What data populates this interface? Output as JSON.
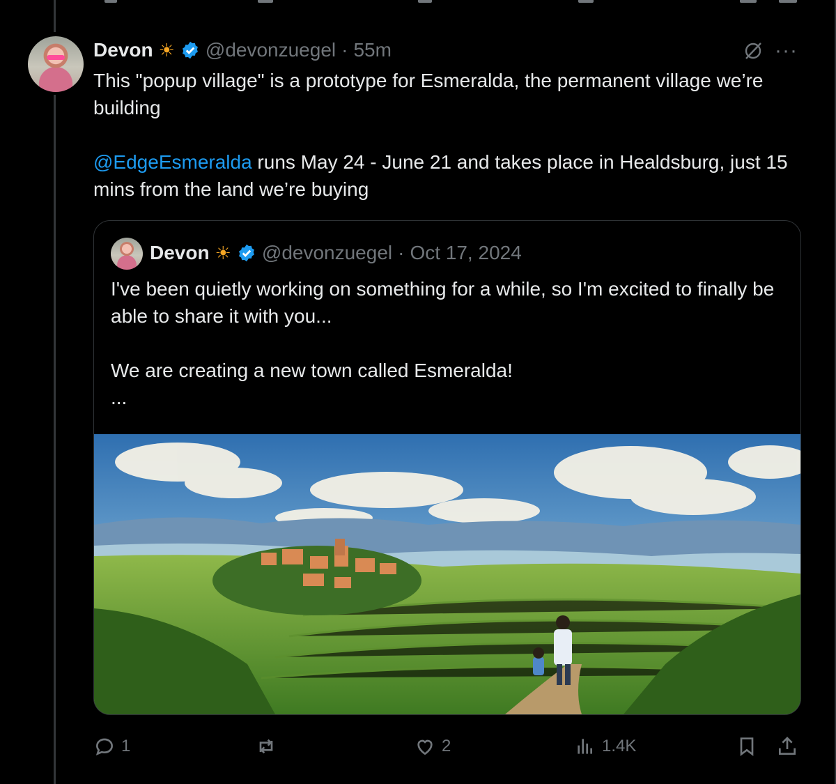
{
  "tweet": {
    "author_name": "Devon",
    "name_emoji": "☀",
    "handle": "@devonzuegel",
    "separator": "·",
    "time": "55m",
    "more_label": "···",
    "line1": "This \"popup village\" is a prototype for Esmeralda, the permanent village we’re building",
    "mention": "@EdgeEsmeralda",
    "line2_rest": " runs May 24 - June 21 and takes place in Healdsburg, just 15 mins from the land we’re buying"
  },
  "quoted_tweet": {
    "author_name": "Devon",
    "name_emoji": "☀",
    "handle": "@devonzuegel",
    "separator": "·",
    "date": "Oct 17, 2024",
    "para1": "I've been quietly working on something for a while, so I'm excited to finally be able to share it with you...",
    "para2": "We are creating a new town called Esmeralda!",
    "ellipsis": "..."
  },
  "actions": {
    "replies": "1",
    "reposts": "",
    "likes": "2",
    "views": "1.4K"
  },
  "colors": {
    "background": "#000000",
    "text": "#e7e9ea",
    "muted": "#71767b",
    "accent": "#1d9bf0",
    "border": "#2f3336"
  },
  "icons": [
    "grok-icon",
    "more-icon",
    "verified-icon",
    "reply-icon",
    "repost-icon",
    "like-icon",
    "views-icon",
    "bookmark-icon",
    "share-icon"
  ]
}
